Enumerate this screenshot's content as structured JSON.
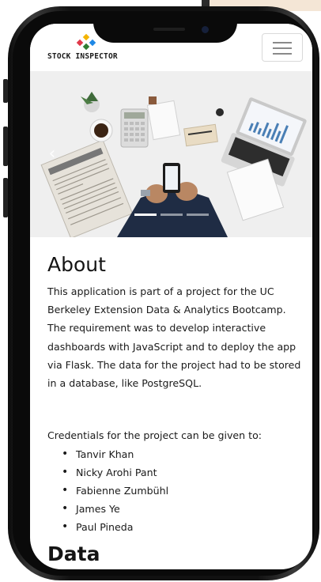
{
  "navbar": {
    "brand": "STOCK INSPECTOR",
    "logo_colors": [
      "#e0394a",
      "#f4b400",
      "#2e7d32",
      "#1e88e5"
    ]
  },
  "carousel": {
    "slide_count": 3,
    "active_index": 0,
    "prev_icon": "chevron-left-icon"
  },
  "about": {
    "heading": "About",
    "paragraph": "This application is part of a project for the UC Berkeley Extension Data & Analytics Bootcamp. The requirement was to develop interactive dashboards with JavaScript and to deploy the app via Flask. The data for the project had to be stored in a database, like PostgreSQL.",
    "credentials_intro": "Credentials for the project can be given to:",
    "team": [
      "Tanvir Khan",
      "Nicky Arohi Pant",
      "Fabienne Zumbühl",
      "James Ye",
      "Paul Pineda"
    ]
  },
  "data_section": {
    "heading": "Data"
  }
}
